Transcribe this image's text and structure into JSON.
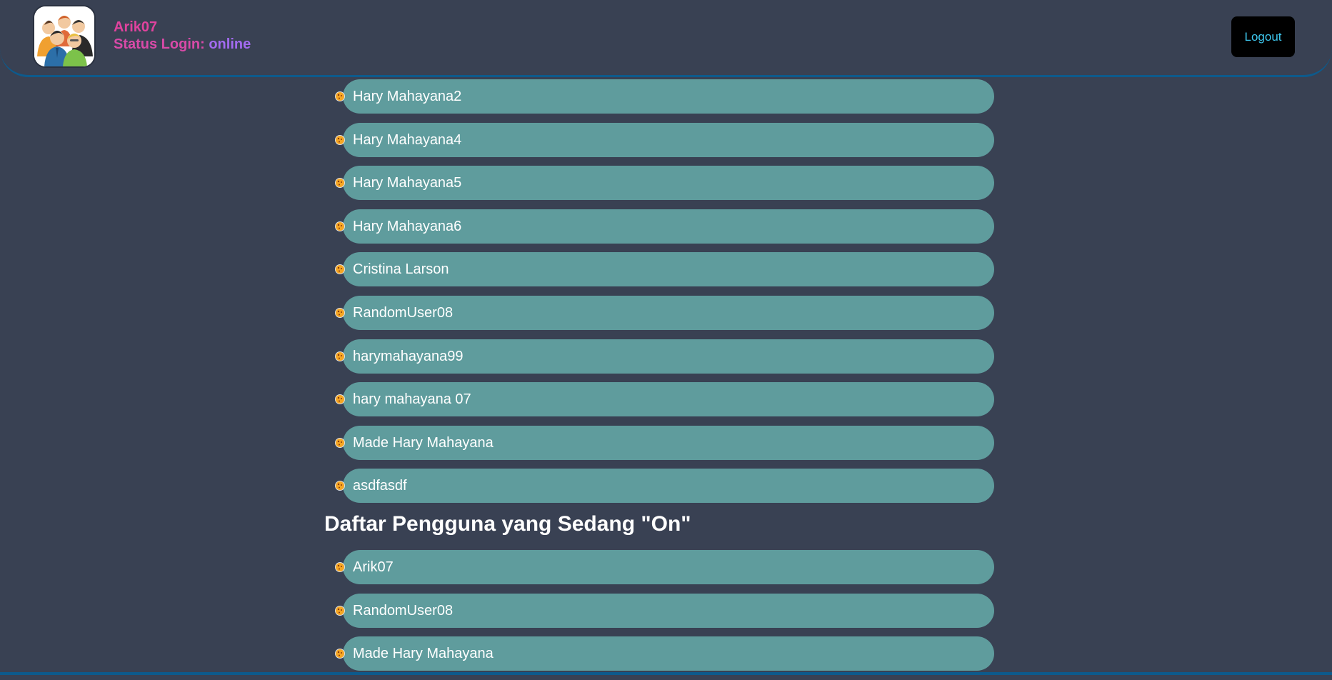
{
  "header": {
    "username": "Arik07",
    "status_label": "Status Login:",
    "status_value": "online",
    "logout_label": "Logout"
  },
  "all_users": {
    "items": [
      {
        "name": "Hary Mahayana2"
      },
      {
        "name": "Hary Mahayana4"
      },
      {
        "name": "Hary Mahayana5"
      },
      {
        "name": "Hary Mahayana6"
      },
      {
        "name": "Cristina Larson"
      },
      {
        "name": "RandomUser08"
      },
      {
        "name": "harymahayana99"
      },
      {
        "name": "hary mahayana 07"
      },
      {
        "name": "Made Hary Mahayana"
      },
      {
        "name": "asdfasdf"
      }
    ]
  },
  "online_users": {
    "title": "Daftar Pengguna yang Sedang \"On\"",
    "items": [
      {
        "name": "Arik07"
      },
      {
        "name": "RandomUser08"
      },
      {
        "name": "Made Hary Mahayana"
      }
    ]
  },
  "colors": {
    "background": "#394153",
    "pill": "#5f9c9d",
    "accent_pink": "#e0439e",
    "accent_purple": "#a36bf0",
    "logout_text": "#3ec9f0",
    "border_blue": "#0d5a8c"
  },
  "icons": {
    "avatar": "group-users-icon",
    "bullet": "cookie-icon"
  }
}
